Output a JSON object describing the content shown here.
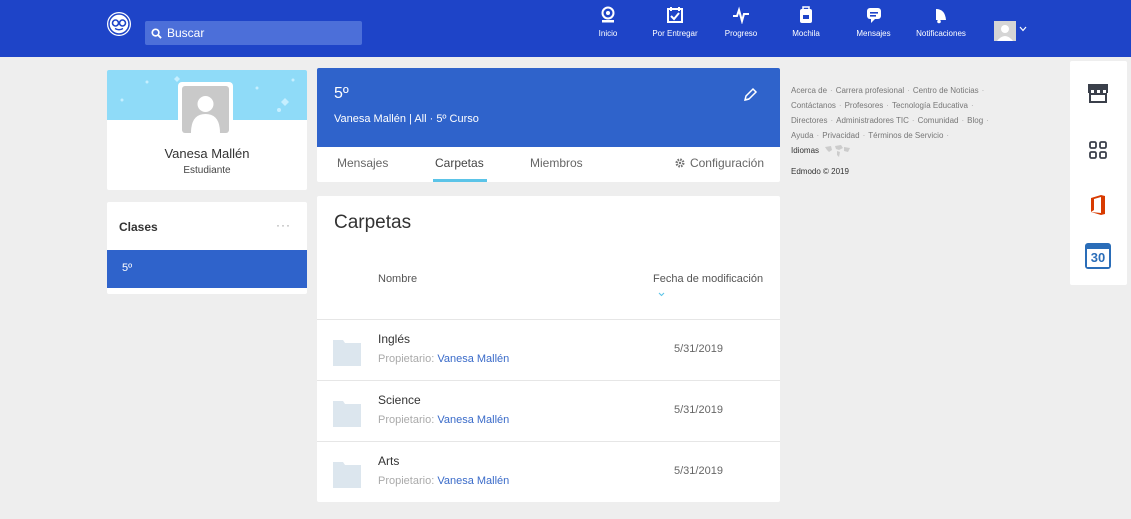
{
  "topnav": {
    "search_placeholder": "Buscar",
    "items": [
      {
        "label": "Inicio",
        "icon": "home-icon"
      },
      {
        "label": "Por Entregar",
        "icon": "calendar-check-icon"
      },
      {
        "label": "Progreso",
        "icon": "pulse-icon"
      },
      {
        "label": "Mochila",
        "icon": "backpack-icon"
      },
      {
        "label": "Mensajes",
        "icon": "chat-icon"
      },
      {
        "label": "Notificaciones",
        "icon": "bell-icon"
      }
    ]
  },
  "profile": {
    "name": "Vanesa Mallén",
    "role": "Estudiante"
  },
  "classes": {
    "title": "Clases",
    "more": "···",
    "items": [
      {
        "label": "5º"
      }
    ]
  },
  "group": {
    "name": "5º",
    "subtitle": "Vanesa Mallén | All  · 5º Curso",
    "tabs": [
      {
        "label": "Mensajes"
      },
      {
        "label": "Carpetas"
      },
      {
        "label": "Miembros"
      }
    ],
    "settings_label": "Configuración"
  },
  "folders": {
    "title": "Carpetas",
    "col_name": "Nombre",
    "col_date": "Fecha de modificación",
    "owner_prefix": "Propietario:",
    "rows": [
      {
        "name": "Inglés",
        "owner": "Vanesa Mallén",
        "date": "5/31/2019"
      },
      {
        "name": "Science",
        "owner": "Vanesa Mallén",
        "date": "5/31/2019"
      },
      {
        "name": "Arts",
        "owner": "Vanesa Mallén",
        "date": "5/31/2019"
      }
    ]
  },
  "footer": {
    "links": [
      "Acerca de",
      "Carrera profesional",
      "Centro de Noticias",
      "Contáctanos",
      "Profesores",
      "Tecnología Educativa",
      "Directores",
      "Administradores TIC",
      "Comunidad",
      "Blog",
      "Ayuda",
      "Privacidad",
      "Términos de Servicio"
    ],
    "languages": "Idiomas",
    "copyright": "Edmodo © 2019"
  },
  "rail": {
    "calendar_day": "30"
  },
  "colors": {
    "nav": "#1e44c8",
    "accent": "#2f63cb",
    "tab_underline": "#5bc4e8",
    "office": "#d83b01"
  }
}
